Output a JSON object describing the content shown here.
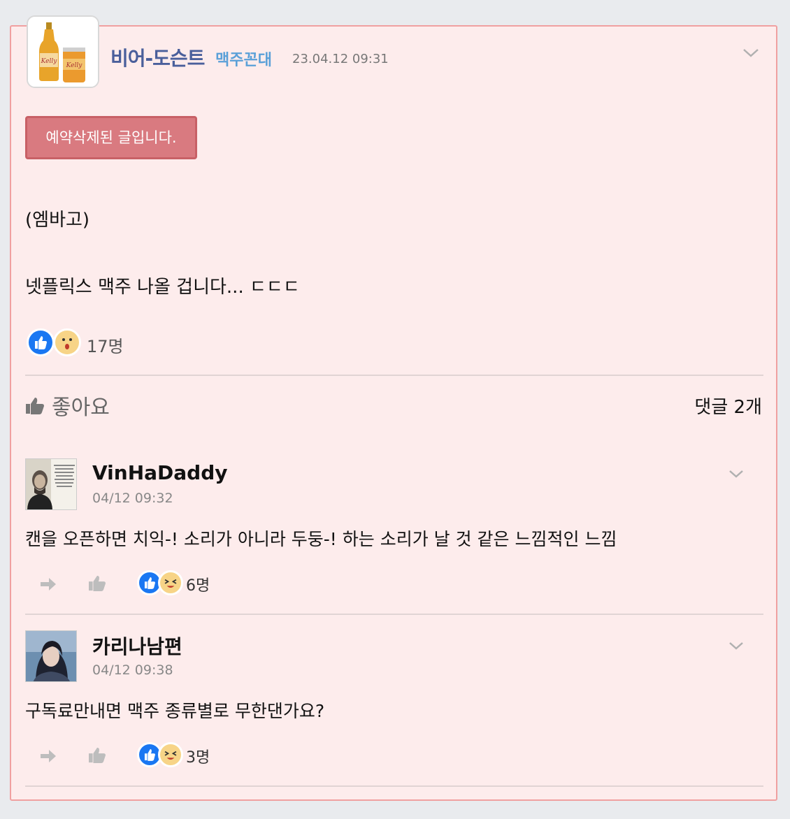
{
  "post": {
    "author": "비어-도슨트",
    "badge": "맥주꼰대",
    "time": "23.04.12 09:31",
    "notice": "예약삭제된 글입니다.",
    "lines": [
      "(엠바고)",
      "넷플릭스 맥주 나올 겁니다... ㄷㄷㄷ"
    ],
    "reaction_count": "17명",
    "like_label": "좋아요",
    "comments_label": "댓글 2개",
    "avatar_icon": "beer-bottle-can-icon"
  },
  "comments": [
    {
      "author": "VinHaDaddy",
      "time": "04/12 09:32",
      "text": "캔을 오픈하면 치익-! 소리가 아니라 두둥-! 하는 소리가 날 것 같은 느낌적인 느낌",
      "reaction_count": "6명"
    },
    {
      "author": "카리나남편",
      "time": "04/12 09:38",
      "text": "구독료만내면 맥주 종류별로 무한댄가요?",
      "reaction_count": "3명"
    }
  ],
  "colors": {
    "card_bg": "#fdecec",
    "card_border": "#f0a0a0",
    "author": "#4a5f9b",
    "badge": "#5aa0d8",
    "notice": "#d97a80",
    "like_blue": "#1a77f2"
  }
}
